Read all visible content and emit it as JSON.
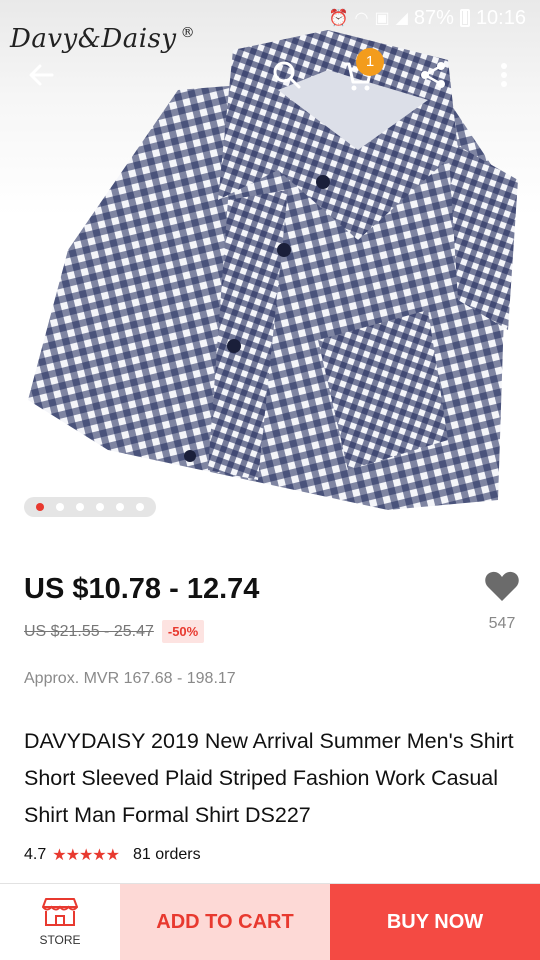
{
  "status_bar": {
    "battery": "87%",
    "time": "10:16"
  },
  "brand": {
    "logo_text": "Davy&Daisy",
    "registered": "®"
  },
  "toolbar": {
    "cart_count": "1"
  },
  "gallery": {
    "total_images": 6,
    "active_index": 0
  },
  "product": {
    "price": "US $10.78 - 12.74",
    "original_price": "US $21.55 - 25.47",
    "discount": "-50%",
    "approx_price": "Approx. MVR 167.68 - 198.17",
    "wishlist_count": "547",
    "title": "DAVYDAISY 2019 New Arrival Summer Men's Shirt Short Sleeved Plaid Striped Fashion Work Casual Shirt Man Formal Shirt DS227",
    "rating": "4.7",
    "stars": "★★★★★",
    "orders": "81 orders"
  },
  "bottom_bar": {
    "store_label": "STORE",
    "add_to_cart": "ADD TO CART",
    "buy_now": "BUY NOW"
  },
  "colors": {
    "accent_red": "#e8392f",
    "badge_orange": "#f39c1c",
    "shirt_navy": "#1f2a5a"
  }
}
